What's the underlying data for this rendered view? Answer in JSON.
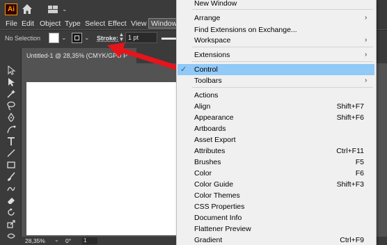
{
  "app": {
    "logo_text": "Ai",
    "brand_color": "#ff9a00"
  },
  "menubar": {
    "items": [
      "File",
      "Edit",
      "Object",
      "Type",
      "Select",
      "Effect",
      "View",
      "Window"
    ]
  },
  "control_bar": {
    "selection_status": "No Selection",
    "fill_color": "#ffffff",
    "stroke_label": "Stroke:",
    "stroke_weight": "1 pt"
  },
  "document_tab": {
    "title": "Untitled-1 @ 28,35% (CMYK/GPU P"
  },
  "status_bar": {
    "zoom": "28,35%",
    "angle": "0°",
    "page": "1"
  },
  "window_menu": {
    "items": [
      {
        "label": "New Window"
      },
      {
        "label": "Arrange",
        "submenu": true
      },
      {
        "label": "Find Extensions on Exchange..."
      },
      {
        "label": "Workspace",
        "submenu": true
      },
      {
        "label": "Extensions",
        "submenu": true
      },
      {
        "label": "Control",
        "checked": true
      },
      {
        "label": "Toolbars",
        "submenu": true
      },
      {
        "label": "Actions"
      },
      {
        "label": "Align",
        "shortcut": "Shift+F7"
      },
      {
        "label": "Appearance",
        "shortcut": "Shift+F6"
      },
      {
        "label": "Artboards"
      },
      {
        "label": "Asset Export"
      },
      {
        "label": "Attributes",
        "shortcut": "Ctrl+F11"
      },
      {
        "label": "Brushes",
        "shortcut": "F5"
      },
      {
        "label": "Color",
        "shortcut": "F6"
      },
      {
        "label": "Color Guide",
        "shortcut": "Shift+F3"
      },
      {
        "label": "Color Themes"
      },
      {
        "label": "CSS Properties"
      },
      {
        "label": "Document Info"
      },
      {
        "label": "Flattener Preview"
      },
      {
        "label": "Gradient",
        "shortcut": "Ctrl+F9"
      }
    ],
    "highlight_color": "#91c9f7"
  },
  "annotation": {
    "arrow_color": "#e8141b"
  }
}
